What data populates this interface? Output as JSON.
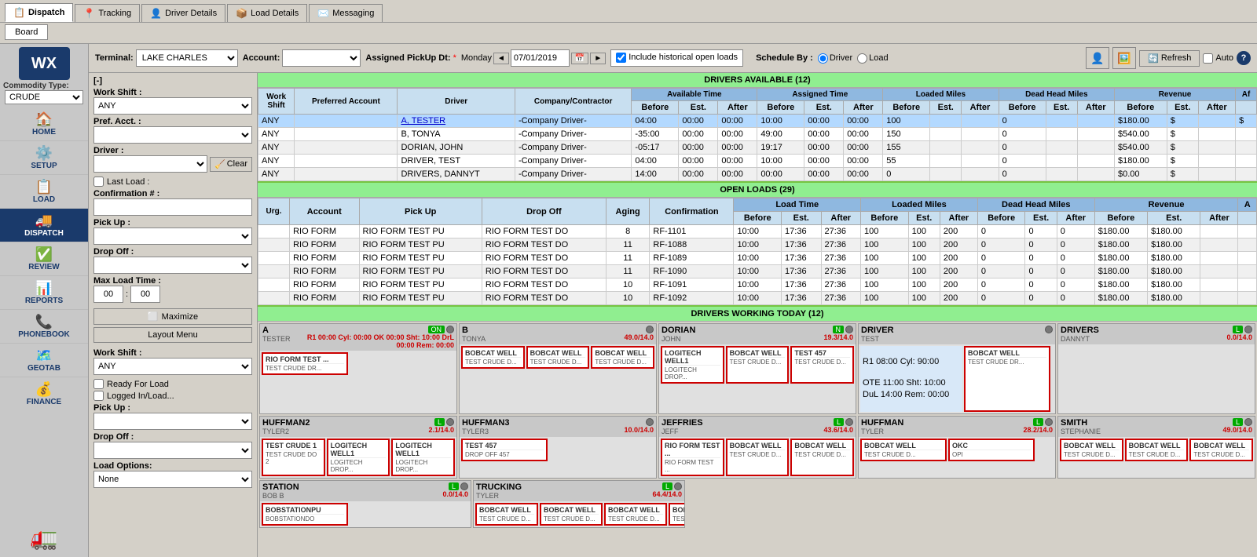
{
  "app": {
    "logo": "WX",
    "commodity_type_label": "Commodity Type:",
    "commodity_options": [
      "CRUDE"
    ],
    "commodity_selected": "CRUDE"
  },
  "nav_tabs": [
    {
      "id": "dispatch",
      "label": "Dispatch",
      "icon": "📋",
      "active": true
    },
    {
      "id": "tracking",
      "label": "Tracking",
      "icon": "📍"
    },
    {
      "id": "driver_details",
      "label": "Driver Details",
      "icon": "👤"
    },
    {
      "id": "load_details",
      "label": "Load Details",
      "icon": "📦"
    },
    {
      "id": "messaging",
      "label": "Messaging",
      "icon": "✉️"
    }
  ],
  "board_tab": {
    "label": "Board"
  },
  "toolbar": {
    "terminal_label": "Terminal:",
    "terminal_value": "LAKE CHARLES",
    "account_label": "Account:",
    "assigned_pickup_label": "Assigned PickUp Dt:",
    "day_label": "Monday",
    "date_value": "07/01/2019",
    "include_label": "Include historical open loads",
    "schedule_by_label": "Schedule By :",
    "driver_option": "Driver",
    "load_option": "Load",
    "refresh_label": "Refresh",
    "auto_label": "Auto",
    "user_icon": "👤",
    "profile_icon": "🖼️",
    "help_icon": "?"
  },
  "filter_panel": {
    "collapse_btn": "[-]",
    "work_shift_label": "Work Shift :",
    "work_shift_value": "ANY",
    "pref_acct_label": "Pref. Acct. :",
    "driver_label": "Driver :",
    "clear_btn": "Clear",
    "last_load_label": "Last Load :",
    "confirmation_label": "Confirmation # :",
    "pickup_label": "Pick Up :",
    "dropoff_label": "Drop Off :",
    "max_load_time_label": "Max Load Time :",
    "time1": "00",
    "time2": "00",
    "ready_for_load": "Ready For Load",
    "logged_in_load": "Logged In/Load...",
    "pickup2_label": "Pick Up :",
    "dropoff2_label": "Drop Off :",
    "load_options_label": "Load Options:",
    "load_options_value": "None",
    "maximize_btn": "Maximize",
    "layout_btn": "Layout Menu"
  },
  "drivers_available": {
    "title": "DRIVERS AVAILABLE (12)",
    "columns": {
      "work_shift": "Work Shift",
      "preferred_account": "Preferred Account",
      "driver": "Driver",
      "company_contractor": "Company/Contractor",
      "available_time": "Available Time",
      "assigned_time": "Assigned Time",
      "loaded_miles": "Loaded Miles",
      "dead_head_miles": "Dead Head Miles",
      "revenue": "Revenue",
      "before": "Before",
      "est": "Est.",
      "after": "After"
    },
    "rows": [
      {
        "work_shift": "ANY",
        "preferred_account": "",
        "driver": "A, TESTER",
        "company": "-Company Driver-",
        "avail_before": "04:00",
        "avail_est": "00:00",
        "avail_after": "00:00",
        "assign_before": "10:00",
        "assign_est": "00:00",
        "assign_after": "00:00",
        "loaded_before": "100",
        "loaded_est": "",
        "loaded_after": "",
        "dh_before": "0",
        "dh_est": "",
        "dh_after": "",
        "rev_before": "$180.00",
        "rev_est": "$",
        "selected": true
      },
      {
        "work_shift": "ANY",
        "preferred_account": "",
        "driver": "B, TONYA",
        "company": "-Company Driver-",
        "avail_before": "-35:00",
        "avail_est": "00:00",
        "avail_after": "00:00",
        "assign_before": "49:00",
        "assign_est": "00:00",
        "assign_after": "00:00",
        "loaded_before": "150",
        "loaded_est": "",
        "loaded_after": "",
        "dh_before": "0",
        "dh_est": "",
        "dh_after": "",
        "rev_before": "$540.00",
        "rev_est": "$"
      },
      {
        "work_shift": "ANY",
        "preferred_account": "",
        "driver": "DORIAN, JOHN",
        "company": "-Company Driver-",
        "avail_before": "-05:17",
        "avail_est": "00:00",
        "avail_after": "00:00",
        "assign_before": "19:17",
        "assign_est": "00:00",
        "assign_after": "00:00",
        "loaded_before": "155",
        "loaded_est": "",
        "loaded_after": "",
        "dh_before": "0",
        "dh_est": "",
        "dh_after": "",
        "rev_before": "$540.00",
        "rev_est": "$"
      },
      {
        "work_shift": "ANY",
        "preferred_account": "",
        "driver": "DRIVER, TEST",
        "company": "-Company Driver-",
        "avail_before": "04:00",
        "avail_est": "00:00",
        "avail_after": "00:00",
        "assign_before": "10:00",
        "assign_est": "00:00",
        "assign_after": "00:00",
        "loaded_before": "55",
        "loaded_est": "",
        "loaded_after": "",
        "dh_before": "0",
        "dh_est": "",
        "dh_after": "",
        "rev_before": "$180.00",
        "rev_est": "$"
      },
      {
        "work_shift": "ANY",
        "preferred_account": "",
        "driver": "DRIVERS, DANNYT",
        "company": "-Company Driver-",
        "avail_before": "14:00",
        "avail_est": "00:00",
        "avail_after": "00:00",
        "assign_before": "00:00",
        "assign_est": "00:00",
        "assign_after": "00:00",
        "loaded_before": "0",
        "loaded_est": "",
        "loaded_after": "",
        "dh_before": "0",
        "dh_est": "",
        "dh_after": "",
        "rev_before": "$0.00",
        "rev_est": "$"
      }
    ]
  },
  "open_loads": {
    "title": "OPEN LOADS (29)",
    "columns": {
      "urg": "Urg.",
      "account": "Account",
      "pick_up": "Pick Up",
      "drop_off": "Drop Off",
      "aging": "Aging",
      "confirmation": "Confirmation",
      "load_time": "Load Time",
      "loaded_miles": "Loaded Miles",
      "dead_head_miles": "Dead Head Miles",
      "revenue": "Revenue",
      "before": "Before",
      "est": "Est.",
      "after": "After"
    },
    "rows": [
      {
        "urg": "",
        "account": "RIO FORM",
        "pickup": "RIO FORM TEST PU",
        "dropoff": "RIO FORM TEST DO",
        "aging": "8",
        "confirmation": "RF-1101",
        "lt_before": "10:00",
        "lt_est": "17:36",
        "lt_after": "27:36",
        "lm_before": "100",
        "lm_est": "100",
        "lm_after": "200",
        "dh_before": "0",
        "dh_est": "0",
        "dh_after": "0",
        "rev_before": "$180.00",
        "rev_est": "$180.00"
      },
      {
        "urg": "",
        "account": "RIO FORM",
        "pickup": "RIO FORM TEST PU",
        "dropoff": "RIO FORM TEST DO",
        "aging": "11",
        "confirmation": "RF-1088",
        "lt_before": "10:00",
        "lt_est": "17:36",
        "lt_after": "27:36",
        "lm_before": "100",
        "lm_est": "100",
        "lm_after": "200",
        "dh_before": "0",
        "dh_est": "0",
        "dh_after": "0",
        "rev_before": "$180.00",
        "rev_est": "$180.00"
      },
      {
        "urg": "",
        "account": "RIO FORM",
        "pickup": "RIO FORM TEST PU",
        "dropoff": "RIO FORM TEST DO",
        "aging": "11",
        "confirmation": "RF-1089",
        "lt_before": "10:00",
        "lt_est": "17:36",
        "lt_after": "27:36",
        "lm_before": "100",
        "lm_est": "100",
        "lm_after": "200",
        "dh_before": "0",
        "dh_est": "0",
        "dh_after": "0",
        "rev_before": "$180.00",
        "rev_est": "$180.00"
      },
      {
        "urg": "",
        "account": "RIO FORM",
        "pickup": "RIO FORM TEST PU",
        "dropoff": "RIO FORM TEST DO",
        "aging": "11",
        "confirmation": "RF-1090",
        "lt_before": "10:00",
        "lt_est": "17:36",
        "lt_after": "27:36",
        "lm_before": "100",
        "lm_est": "100",
        "lm_after": "200",
        "dh_before": "0",
        "dh_est": "0",
        "dh_after": "0",
        "rev_before": "$180.00",
        "rev_est": "$180.00"
      },
      {
        "urg": "",
        "account": "RIO FORM",
        "pickup": "RIO FORM TEST PU",
        "dropoff": "RIO FORM TEST DO",
        "aging": "10",
        "confirmation": "RF-1091",
        "lt_before": "10:00",
        "lt_est": "17:36",
        "lt_after": "27:36",
        "lm_before": "100",
        "lm_est": "100",
        "lm_after": "200",
        "dh_before": "0",
        "dh_est": "0",
        "dh_after": "0",
        "rev_before": "$180.00",
        "rev_est": "$180.00"
      },
      {
        "urg": "",
        "account": "RIO FORM",
        "pickup": "RIO FORM TEST PU",
        "dropoff": "RIO FORM TEST DO",
        "aging": "10",
        "confirmation": "RF-1092",
        "lt_before": "10:00",
        "lt_est": "17:36",
        "lt_after": "27:36",
        "lm_before": "100",
        "lm_est": "100",
        "lm_after": "200",
        "dh_before": "0",
        "dh_est": "0",
        "dh_after": "0",
        "rev_before": "$180.00",
        "rev_est": "$180.00"
      }
    ]
  },
  "drivers_working": {
    "title": "DRIVERS WORKING TODAY (12)",
    "drivers": [
      {
        "id": "A",
        "name": "A",
        "sub": "TESTER",
        "status": "ON",
        "metrics": "R1  00:00 Cyl: 00:00\nOK  00:00 Sht: 10:00\nDrL 00:00 Rem: 00:00",
        "miles": "",
        "loads": [
          {
            "title": "RIO FORM TEST ...",
            "sub": "TEST CRUDE DR...",
            "color": "red"
          },
          {
            "title": "",
            "sub": "",
            "color": "empty"
          }
        ]
      },
      {
        "id": "B",
        "name": "B",
        "sub": "TONYA",
        "status": "",
        "metrics": "49.0/14.0",
        "loads": [
          {
            "title": "BOBCAT WELL",
            "sub": "TEST CRUDE D...",
            "color": "red"
          },
          {
            "title": "BOBCAT WELL",
            "sub": "TEST CRUDE D...",
            "color": "red"
          },
          {
            "title": "BOBCAT WELL",
            "sub": "TEST CRUDE D...",
            "color": "red"
          }
        ]
      },
      {
        "id": "DORIAN",
        "name": "DORIAN",
        "sub": "JOHN",
        "status": "N",
        "metrics": "19.3/14.0",
        "loads": [
          {
            "title": "LOGITECH WELL1",
            "sub": "LOGITECH DROP...",
            "color": "red"
          },
          {
            "title": "BOBCAT WELL",
            "sub": "TEST CRUDE D...",
            "color": "red"
          },
          {
            "title": "TEST 457",
            "sub": "TEST CRUDE D...",
            "color": "red"
          }
        ]
      },
      {
        "id": "DRIVER",
        "name": "DRIVER",
        "sub": "TEST",
        "status": "",
        "metrics": "",
        "loads": [
          {
            "title": "R1 08:00 Cyl: 90:00",
            "sub": "OTE  11:00 Sht: 10:00\nDuL 14:00 Rem: 00:00",
            "color": "none"
          },
          {
            "title": "BOBCAT WELL",
            "sub": "TEST CRUDE DR...",
            "color": "red"
          }
        ]
      },
      {
        "id": "DRIVERS",
        "name": "DRIVERS",
        "sub": "DANNYT",
        "status": "L",
        "metrics": "0.0/14.0",
        "loads": []
      },
      {
        "id": "HUFFMAN2",
        "name": "HUFFMAN2",
        "sub": "TYLER2",
        "status": "L",
        "metrics": "2.1/14.0",
        "loads": [
          {
            "title": "TEST CRUDE 1",
            "sub": "TEST CRUDE DO 2",
            "color": "red"
          },
          {
            "title": "LOGITECH WELL1",
            "sub": "LOGITECH DROP...",
            "color": "red"
          },
          {
            "title": "LOGITECH WELL1",
            "sub": "LOGITECH DROP...",
            "color": "red"
          }
        ]
      },
      {
        "id": "HUFFMAN3",
        "name": "HUFFMAN3",
        "sub": "TYLER3",
        "status": "",
        "metrics": "10.0/14.0",
        "loads": [
          {
            "title": "TEST 457",
            "sub": "DROP OFF 457",
            "color": "red"
          }
        ]
      },
      {
        "id": "JEFFRIES",
        "name": "JEFFRIES",
        "sub": "JEFF",
        "status": "L",
        "metrics": "43.6/14.0",
        "loads": [
          {
            "title": "RIO FORM TEST ...",
            "sub": "RIO FORM TEST ...",
            "color": "red"
          },
          {
            "title": "BOBCAT WELL",
            "sub": "TEST CRUDE D...",
            "color": "red"
          },
          {
            "title": "BOBCAT WELL",
            "sub": "TEST CRUDE D...",
            "color": "red"
          }
        ]
      },
      {
        "id": "HUFFMAN_T",
        "name": "HUFFMAN",
        "sub": "TYLER",
        "status": "L",
        "metrics": "28.2/14.0",
        "loads": [
          {
            "title": "BOBCAT WELL",
            "sub": "TEST CRUDE D...",
            "color": "red"
          },
          {
            "title": "OKC",
            "sub": "OPI",
            "color": "red"
          }
        ]
      },
      {
        "id": "SMITH",
        "name": "SMITH",
        "sub": "STEPHANIE",
        "status": "L",
        "metrics": "49.0/14.0",
        "loads": [
          {
            "title": "BOBCAT WELL",
            "sub": "TEST CRUDE D...",
            "color": "red"
          },
          {
            "title": "BOBCAT WELL",
            "sub": "TEST CRUDE D...",
            "color": "red"
          },
          {
            "title": "BOBCAT WELL",
            "sub": "TEST CRUDE D...",
            "color": "red"
          }
        ]
      },
      {
        "id": "STATION",
        "name": "STATION",
        "sub": "BOB B",
        "status": "L",
        "metrics": "0.0/14.0",
        "loads": [
          {
            "title": "BOBSTATIONPU",
            "sub": "BOBSTATIONDO",
            "color": "red"
          }
        ]
      },
      {
        "id": "TRUCKING",
        "name": "TRUCKING",
        "sub": "TYLER",
        "status": "L",
        "metrics": "64.4/14.0",
        "loads": [
          {
            "title": "BOBCAT WELL",
            "sub": "TEST CRUDE D...",
            "color": "red"
          },
          {
            "title": "BOBCAT WELL",
            "sub": "TEST CRUDE D...",
            "color": "red"
          },
          {
            "title": "BOBCAT WELL",
            "sub": "TEST CRUDE D...",
            "color": "red"
          },
          {
            "title": "BOBCAT WELL",
            "sub": "TEST CRUDE D...",
            "color": "red"
          }
        ]
      }
    ]
  },
  "sidebar_items": [
    {
      "id": "home",
      "label": "HOME",
      "icon": "🏠"
    },
    {
      "id": "setup",
      "label": "SETUP",
      "icon": "⚙️"
    },
    {
      "id": "load",
      "label": "LOAD",
      "icon": "📋"
    },
    {
      "id": "dispatch",
      "label": "DISPATCH",
      "icon": "🚚",
      "active": true
    },
    {
      "id": "review",
      "label": "REVIEW",
      "icon": "✅"
    },
    {
      "id": "reports",
      "label": "REPORTS",
      "icon": "📊"
    },
    {
      "id": "phonebook",
      "label": "PHONEBOOK",
      "icon": "📞"
    },
    {
      "id": "geotab",
      "label": "GEOTAB",
      "icon": "🗺️"
    },
    {
      "id": "finance",
      "label": "FINANCE",
      "icon": "💰"
    }
  ]
}
